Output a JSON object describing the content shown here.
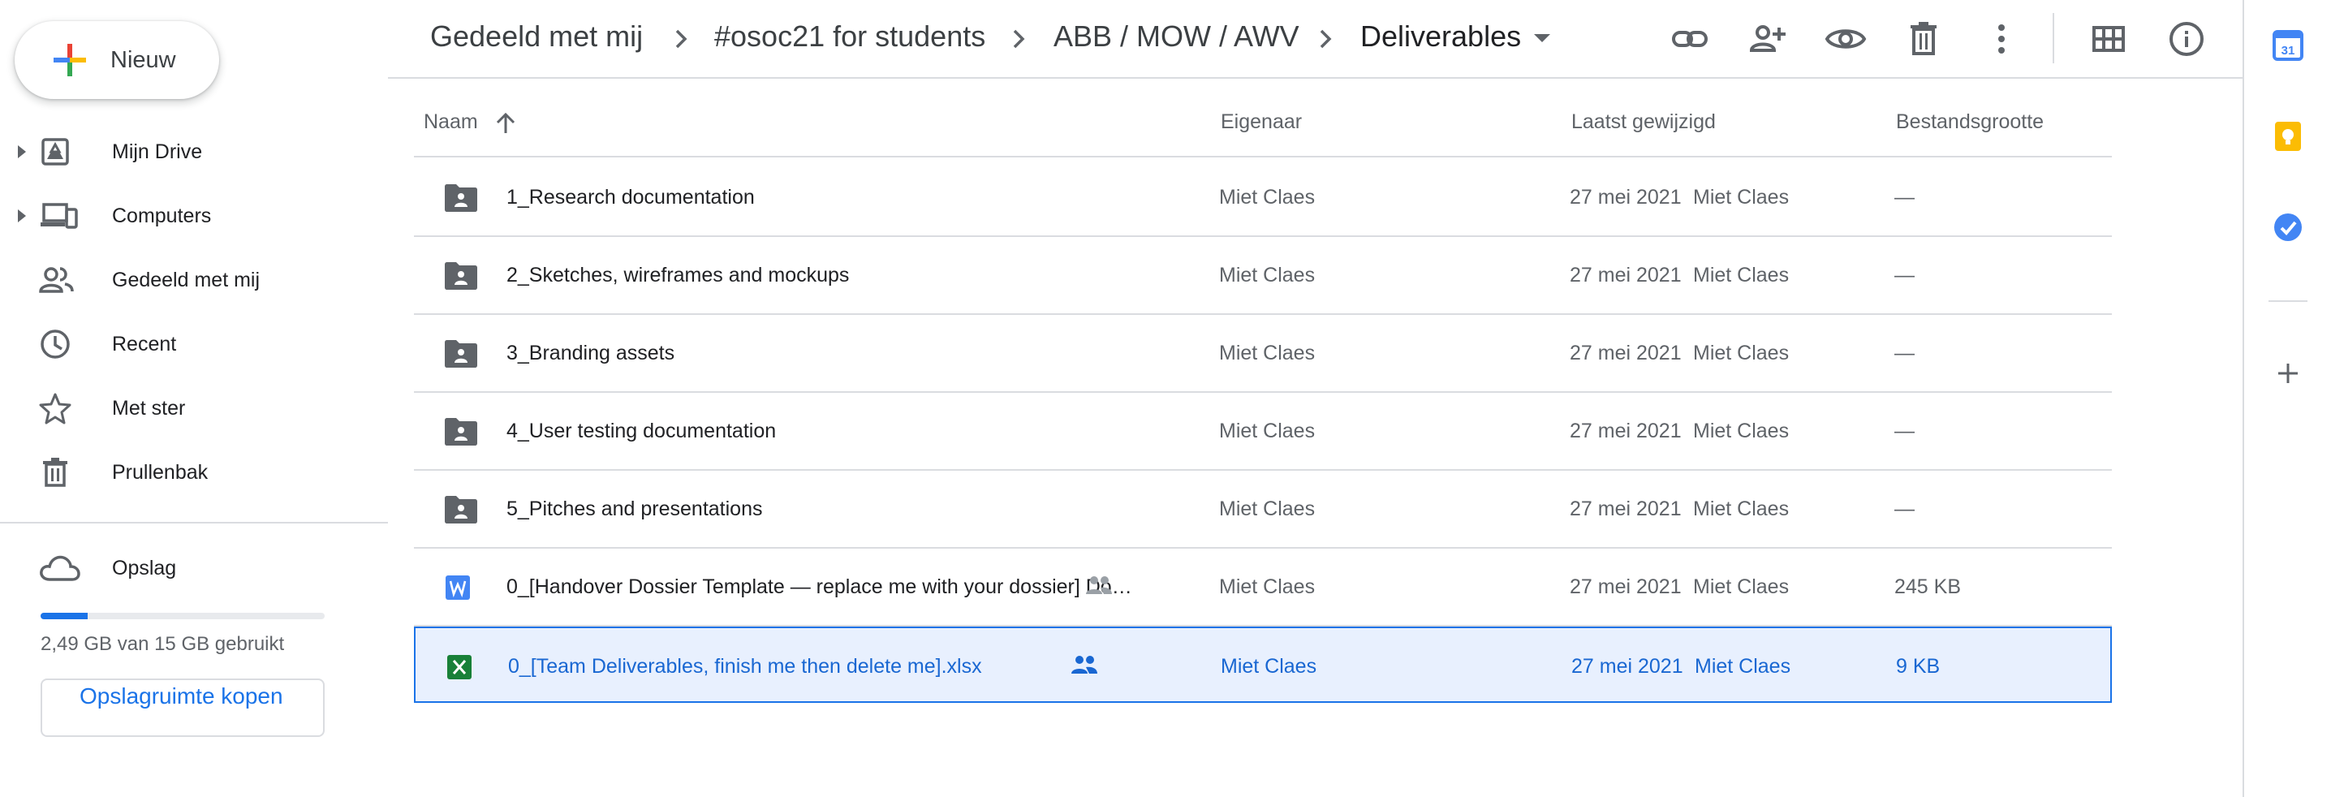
{
  "sidebar": {
    "new_label": "Nieuw",
    "items": [
      {
        "label": "Mijn Drive",
        "icon": "my-drive-icon"
      },
      {
        "label": "Computers",
        "icon": "computers-icon"
      },
      {
        "label": "Gedeeld met mij",
        "icon": "shared-with-me-icon"
      },
      {
        "label": "Recent",
        "icon": "clock-icon"
      },
      {
        "label": "Met ster",
        "icon": "star-icon"
      },
      {
        "label": "Prullenbak",
        "icon": "trash-icon"
      }
    ],
    "storage": {
      "label": "Opslag",
      "used_text": "2,49 GB van 15 GB gebruikt",
      "used_fraction": 0.166,
      "buy_label": "Opslagruimte kopen"
    }
  },
  "breadcrumb": [
    "Gedeeld met mij",
    "#osoc21 for students",
    "ABB / MOW / AWV",
    "Deliverables"
  ],
  "toolbar": [
    "link-icon",
    "add-person-icon",
    "preview-icon",
    "trash-icon",
    "more-vert-icon",
    "grid-view-icon",
    "info-icon"
  ],
  "table": {
    "headers": {
      "name": "Naam",
      "owner": "Eigenaar",
      "modified": "Laatst gewijzigd",
      "size": "Bestandsgrootte"
    },
    "rows": [
      {
        "type": "shared-folder",
        "name": "1_Research documentation",
        "owner": "Miet Claes",
        "date": "27 mei 2021",
        "modified_by": "Miet Claes",
        "size": "—"
      },
      {
        "type": "shared-folder",
        "name": "2_Sketches, wireframes and mockups",
        "owner": "Miet Claes",
        "date": "27 mei 2021",
        "modified_by": "Miet Claes",
        "size": "—"
      },
      {
        "type": "shared-folder",
        "name": "3_Branding assets",
        "owner": "Miet Claes",
        "date": "27 mei 2021",
        "modified_by": "Miet Claes",
        "size": "—"
      },
      {
        "type": "shared-folder",
        "name": "4_User testing documentation",
        "owner": "Miet Claes",
        "date": "27 mei 2021",
        "modified_by": "Miet Claes",
        "size": "—"
      },
      {
        "type": "shared-folder",
        "name": "5_Pitches and presentations",
        "owner": "Miet Claes",
        "date": "27 mei 2021",
        "modified_by": "Miet Claes",
        "size": "—"
      },
      {
        "type": "word",
        "name": "0_[Handover Dossier Template — replace me with your dossier] Do…",
        "owner": "Miet Claes",
        "date": "27 mei 2021",
        "modified_by": "Miet Claes",
        "size": "245 KB",
        "shared": true
      },
      {
        "type": "excel",
        "name": "0_[Team Deliverables, finish me then delete me].xlsx",
        "owner": "Miet Claes",
        "date": "27 mei 2021",
        "modified_by": "Miet Claes",
        "size": "9 KB",
        "shared": true,
        "selected": true
      }
    ]
  },
  "rail": [
    "calendar-icon",
    "keep-icon",
    "tasks-icon",
    "add-icon"
  ],
  "colors": {
    "accent": "#1a73e8",
    "selected_bg": "#e8f0fe",
    "word": "#4285f4",
    "excel": "#188038"
  }
}
